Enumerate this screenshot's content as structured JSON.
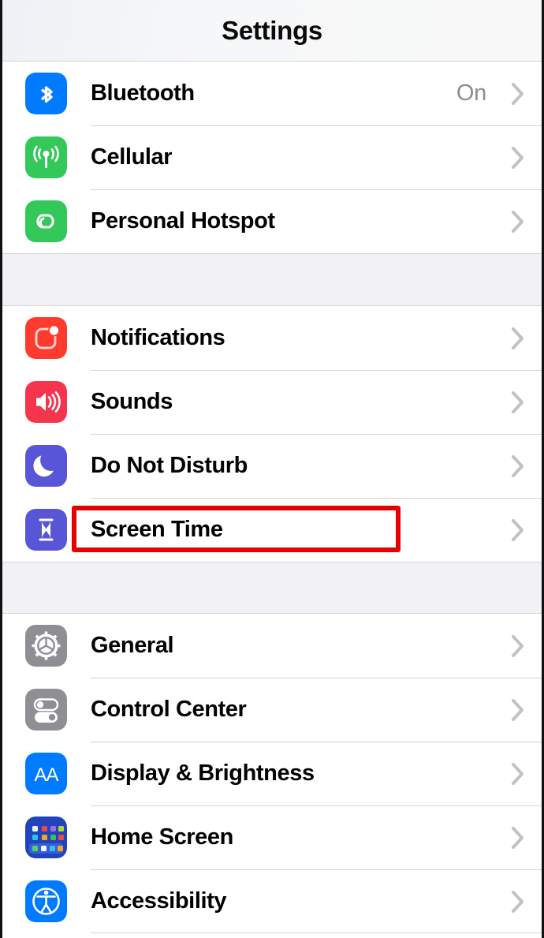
{
  "header": {
    "title": "Settings"
  },
  "colors": {
    "bluetooth": "#007aff",
    "cellular": "#34c759",
    "hotspot": "#34c759",
    "notifications": "#ff3b30",
    "sounds": "#f5344e",
    "do_not_disturb": "#5856d6",
    "screen_time": "#5856d6",
    "general": "#8e8e93",
    "control_center": "#8e8e93",
    "display_brightness": "#007aff",
    "home_screen": "#2244bb",
    "accessibility": "#007aff",
    "highlight": "#e60000",
    "value_text": "#8c8c90",
    "chevron": "#c2c2c6",
    "group_gap": "#f1f1f6",
    "separator": "#d4d4d8"
  },
  "groups": [
    {
      "name": "connectivity",
      "rows": [
        {
          "label": "Bluetooth",
          "value": "On",
          "icon": "bluetooth-icon",
          "chevron": true
        },
        {
          "label": "Cellular",
          "value": "",
          "icon": "cellular-icon",
          "chevron": true
        },
        {
          "label": "Personal Hotspot",
          "value": "",
          "icon": "personal-hotspot-icon",
          "chevron": true
        }
      ]
    },
    {
      "name": "alerts",
      "rows": [
        {
          "label": "Notifications",
          "value": "",
          "icon": "notifications-icon",
          "chevron": true
        },
        {
          "label": "Sounds",
          "value": "",
          "icon": "sounds-icon",
          "chevron": true
        },
        {
          "label": "Do Not Disturb",
          "value": "",
          "icon": "do-not-disturb-icon",
          "chevron": true
        },
        {
          "label": "Screen Time",
          "value": "",
          "icon": "screen-time-icon",
          "chevron": true,
          "highlighted": true
        }
      ]
    },
    {
      "name": "system",
      "rows": [
        {
          "label": "General",
          "value": "",
          "icon": "general-icon",
          "chevron": true
        },
        {
          "label": "Control Center",
          "value": "",
          "icon": "control-center-icon",
          "chevron": true
        },
        {
          "label": "Display & Brightness",
          "value": "",
          "icon": "display-brightness-icon",
          "chevron": true
        },
        {
          "label": "Home Screen",
          "value": "",
          "icon": "home-screen-icon",
          "chevron": true
        },
        {
          "label": "Accessibility",
          "value": "",
          "icon": "accessibility-icon",
          "chevron": true
        }
      ]
    }
  ]
}
